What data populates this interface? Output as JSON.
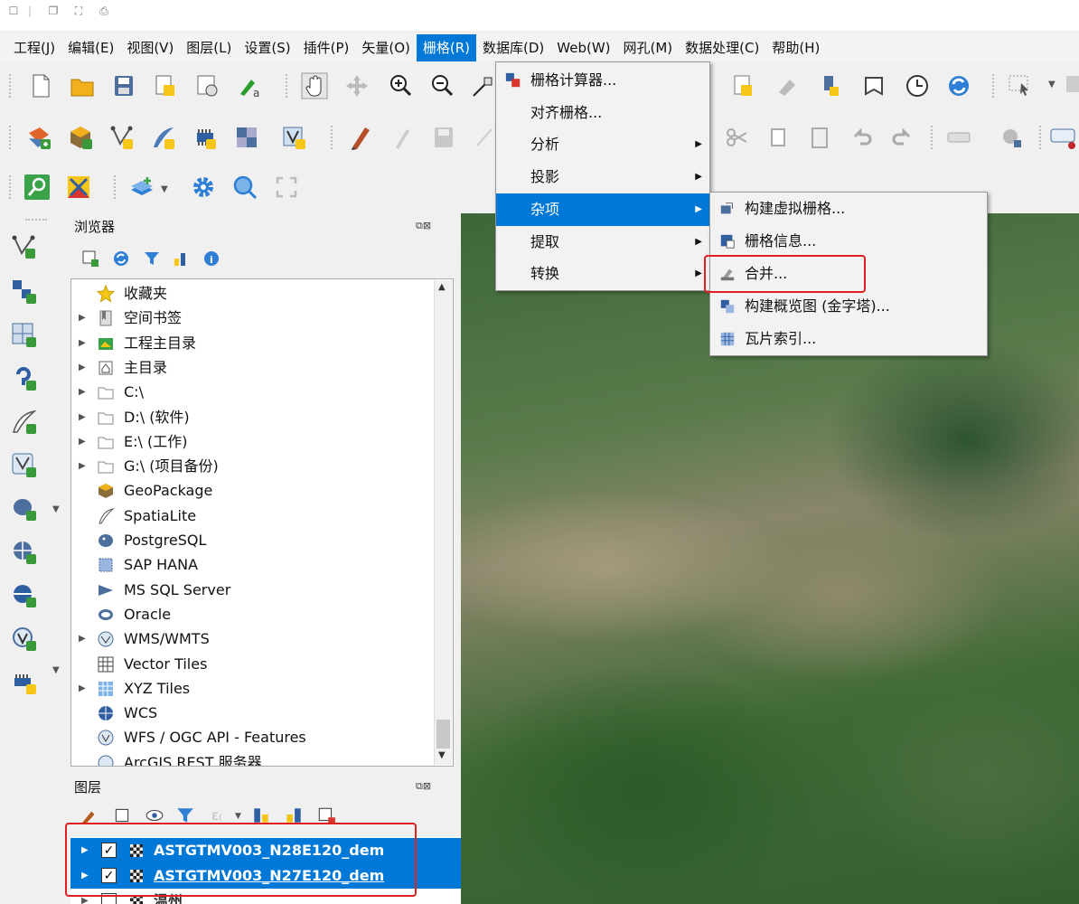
{
  "top_icons": [
    "edit-icon",
    "copy-icon",
    "fit-icon",
    "save-icon"
  ],
  "menubar": {
    "items": [
      "工程(J)",
      "编辑(E)",
      "视图(V)",
      "图层(L)",
      "设置(S)",
      "插件(P)",
      "矢量(O)",
      "栅格(R)",
      "数据库(D)",
      "Web(W)",
      "网孔(M)",
      "数据处理(C)",
      "帮助(H)"
    ],
    "active": "栅格(R)"
  },
  "raster_menu": {
    "items": [
      {
        "label": "栅格计算器...",
        "icon": "raster-calculator-icon",
        "submenu": false
      },
      {
        "label": "对齐栅格...",
        "submenu": false
      },
      {
        "label": "分析",
        "submenu": true
      },
      {
        "label": "投影",
        "submenu": true
      },
      {
        "label": "杂项",
        "submenu": true,
        "highlighted": true
      },
      {
        "label": "提取",
        "submenu": true
      },
      {
        "label": "转换",
        "submenu": true
      }
    ]
  },
  "misc_submenu": {
    "items": [
      {
        "label": "构建虚拟栅格...",
        "icon": "virtual-raster-icon"
      },
      {
        "label": "栅格信息...",
        "icon": "raster-info-icon"
      },
      {
        "label": "合并...",
        "icon": "merge-icon",
        "boxed": true
      },
      {
        "label": "构建概览图 (金字塔)...",
        "icon": "pyramids-icon"
      },
      {
        "label": "瓦片索引...",
        "icon": "tile-index-icon"
      }
    ]
  },
  "browser": {
    "title": "浏览器",
    "items": [
      {
        "label": "收藏夹",
        "icon": "star-icon",
        "expandable": false
      },
      {
        "label": "空间书签",
        "icon": "bookmark-icon",
        "expandable": true
      },
      {
        "label": "工程主目录",
        "icon": "project-home-icon",
        "expandable": true
      },
      {
        "label": "主目录",
        "icon": "home-icon",
        "expandable": true
      },
      {
        "label": "C:\\",
        "icon": "folder-icon",
        "expandable": true
      },
      {
        "label": "D:\\ (软件)",
        "icon": "folder-icon",
        "expandable": true
      },
      {
        "label": "E:\\ (工作)",
        "icon": "folder-icon",
        "expandable": true
      },
      {
        "label": "G:\\ (项目备份)",
        "icon": "folder-icon",
        "expandable": true
      },
      {
        "label": "GeoPackage",
        "icon": "geopackage-icon",
        "expandable": false
      },
      {
        "label": "SpatiaLite",
        "icon": "spatialite-icon",
        "expandable": false
      },
      {
        "label": "PostgreSQL",
        "icon": "postgresql-icon",
        "expandable": false
      },
      {
        "label": "SAP HANA",
        "icon": "sap-hana-icon",
        "expandable": false
      },
      {
        "label": "MS SQL Server",
        "icon": "mssql-icon",
        "expandable": false
      },
      {
        "label": "Oracle",
        "icon": "oracle-icon",
        "expandable": false
      },
      {
        "label": "WMS/WMTS",
        "icon": "wms-icon",
        "expandable": true
      },
      {
        "label": "Vector Tiles",
        "icon": "vector-tiles-icon",
        "expandable": false
      },
      {
        "label": "XYZ Tiles",
        "icon": "xyz-tiles-icon",
        "expandable": true
      },
      {
        "label": "WCS",
        "icon": "wcs-icon",
        "expandable": false
      },
      {
        "label": "WFS / OGC API - Features",
        "icon": "wfs-icon",
        "expandable": false
      },
      {
        "label": "ArcGIS REST 服务器",
        "icon": "arcgis-icon",
        "expandable": false
      }
    ]
  },
  "layers": {
    "title": "图层",
    "items": [
      {
        "name": "ASTGTMV003_N28E120_dem",
        "checked": true,
        "selected": true
      },
      {
        "name": "ASTGTMV003_N27E120_dem",
        "checked": true,
        "selected": true
      },
      {
        "name": "温州",
        "checked": false,
        "selected": false
      }
    ]
  },
  "colors": {
    "accent": "#0078d7",
    "highlight_box": "#e02020"
  }
}
